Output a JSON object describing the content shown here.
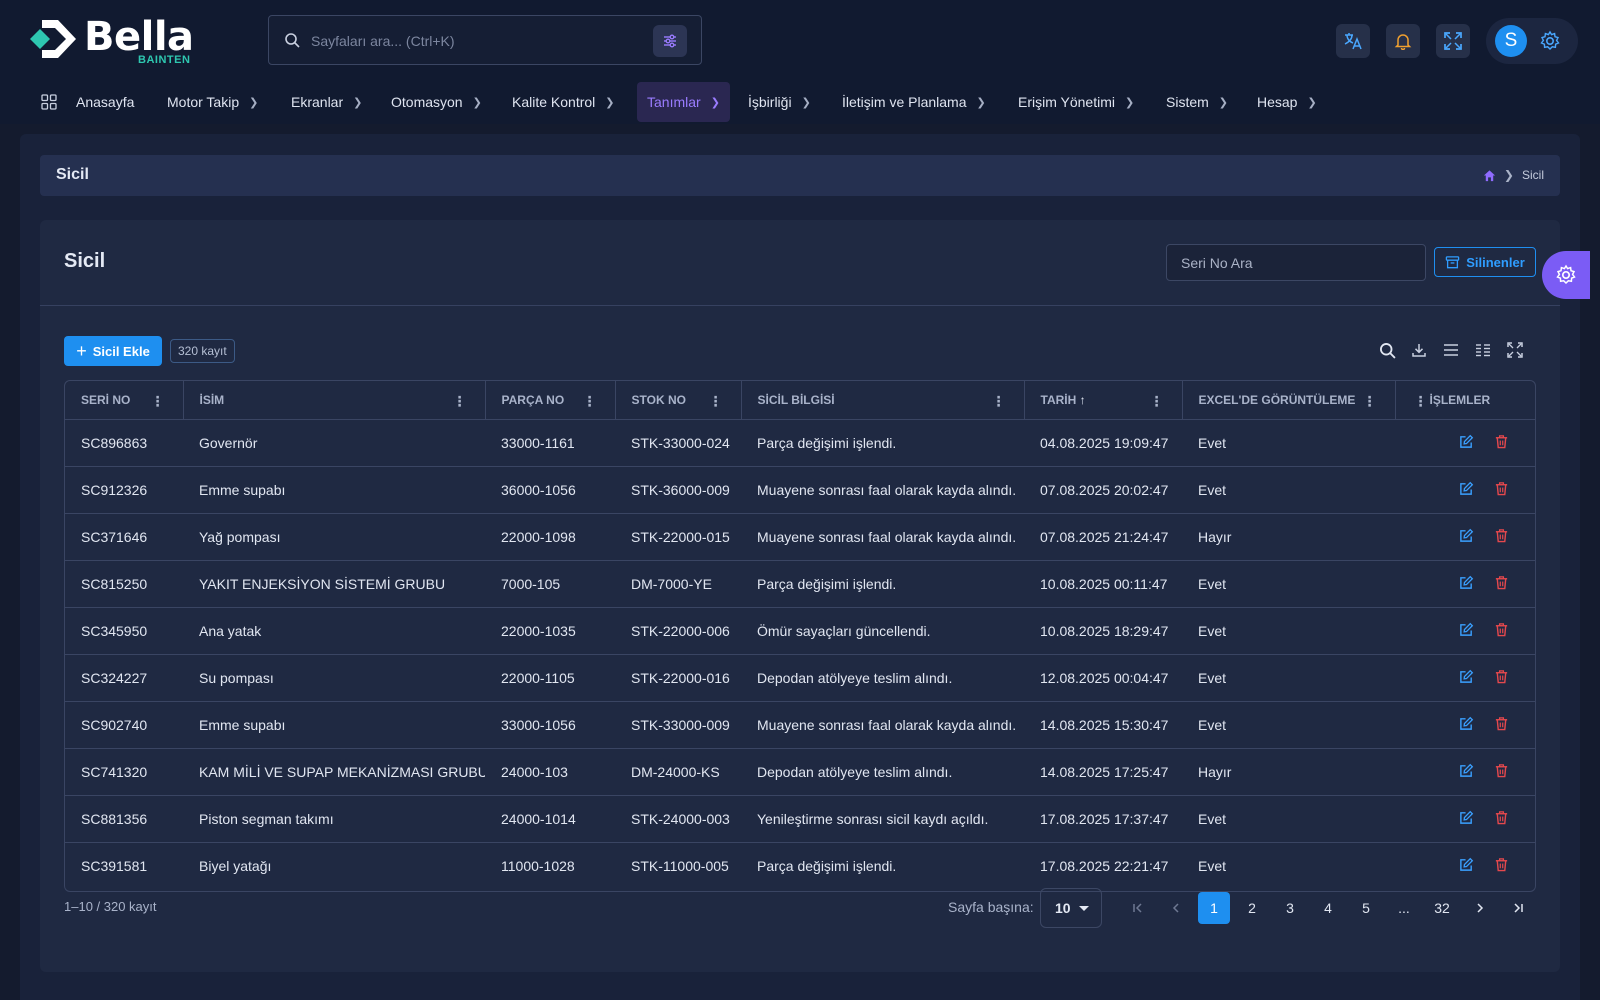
{
  "header": {
    "brand": "Bella",
    "brand_sub": "BAINTEN",
    "search_placeholder": "Sayfaları ara... (Ctrl+K)",
    "user_initial": "S"
  },
  "nav": [
    {
      "label": "Anasayfa"
    },
    {
      "label": "Motor Takip"
    },
    {
      "label": "Ekranlar"
    },
    {
      "label": "Otomasyon"
    },
    {
      "label": "Kalite Kontrol"
    },
    {
      "label": "Tanımlar",
      "active": true
    },
    {
      "label": "İşbirliği"
    },
    {
      "label": "İletişim ve Planlama"
    },
    {
      "label": "Erişim Yönetimi"
    },
    {
      "label": "Sistem"
    },
    {
      "label": "Hesap"
    }
  ],
  "breadcrumb": {
    "page_title": "Sicil",
    "current": "Sicil"
  },
  "card": {
    "title": "Sicil",
    "seri_placeholder": "Seri No Ara",
    "deleted_label": "Silinenler",
    "add_label": "Sicil Ekle",
    "count_badge": "320 kayıt"
  },
  "table": {
    "columns": [
      "SERİ NO",
      "İSİM",
      "PARÇA NO",
      "STOK NO",
      "SİCİL BİLGİSİ",
      "TARİH",
      "EXCEL'DE GÖRÜNTÜLEME",
      "İŞLEMLER"
    ],
    "sort_indicator": "↑",
    "rows": [
      {
        "seri": "SC896863",
        "isim": "Governör",
        "parca": "33000-1161",
        "stok": "STK-33000-024",
        "bilgi": "Parça değişimi işlendi.",
        "tarih": "04.08.2025 19:09:47",
        "excel": "Evet"
      },
      {
        "seri": "SC912326",
        "isim": "Emme supabı",
        "parca": "36000-1056",
        "stok": "STK-36000-009",
        "bilgi": "Muayene sonrası faal olarak kayda alındı.",
        "tarih": "07.08.2025 20:02:47",
        "excel": "Evet"
      },
      {
        "seri": "SC371646",
        "isim": "Yağ pompası",
        "parca": "22000-1098",
        "stok": "STK-22000-015",
        "bilgi": "Muayene sonrası faal olarak kayda alındı.",
        "tarih": "07.08.2025 21:24:47",
        "excel": "Hayır"
      },
      {
        "seri": "SC815250",
        "isim": "YAKIT ENJEKSİYON SİSTEMİ GRUBU",
        "parca": "7000-105",
        "stok": "DM-7000-YE",
        "bilgi": "Parça değişimi işlendi.",
        "tarih": "10.08.2025 00:11:47",
        "excel": "Evet"
      },
      {
        "seri": "SC345950",
        "isim": "Ana yatak",
        "parca": "22000-1035",
        "stok": "STK-22000-006",
        "bilgi": "Ömür sayaçları güncellendi.",
        "tarih": "10.08.2025 18:29:47",
        "excel": "Evet"
      },
      {
        "seri": "SC324227",
        "isim": "Su pompası",
        "parca": "22000-1105",
        "stok": "STK-22000-016",
        "bilgi": "Depodan atölyeye teslim alındı.",
        "tarih": "12.08.2025 00:04:47",
        "excel": "Evet"
      },
      {
        "seri": "SC902740",
        "isim": "Emme supabı",
        "parca": "33000-1056",
        "stok": "STK-33000-009",
        "bilgi": "Muayene sonrası faal olarak kayda alındı.",
        "tarih": "14.08.2025 15:30:47",
        "excel": "Evet"
      },
      {
        "seri": "SC741320",
        "isim": "KAM MİLİ VE SUPAP MEKANİZMASI GRUBU",
        "parca": "24000-103",
        "stok": "DM-24000-KS",
        "bilgi": "Depodan atölyeye teslim alındı.",
        "tarih": "14.08.2025 17:25:47",
        "excel": "Hayır"
      },
      {
        "seri": "SC881356",
        "isim": "Piston segman takımı",
        "parca": "24000-1014",
        "stok": "STK-24000-003",
        "bilgi": "Yenileştirme sonrası sicil kaydı açıldı.",
        "tarih": "17.08.2025 17:37:47",
        "excel": "Evet"
      },
      {
        "seri": "SC391581",
        "isim": "Biyel yatağı",
        "parca": "11000-1028",
        "stok": "STK-11000-005",
        "bilgi": "Parça değişimi işlendi.",
        "tarih": "17.08.2025 22:21:47",
        "excel": "Evet"
      }
    ]
  },
  "footer": {
    "range": "1–10 / 320 kayıt",
    "per_page_label": "Sayfa başına:",
    "per_page_value": "10",
    "pages": [
      "1",
      "2",
      "3",
      "4",
      "5",
      "...",
      "32"
    ],
    "current_page": "1"
  },
  "colors": {
    "accent": "#1e8ff0",
    "nav_active": "#9a7cff",
    "danger": "#e5484d",
    "background": "#141b2e"
  },
  "icons": [
    "logo-mark-icon",
    "search-icon",
    "filter-icon",
    "translate-icon",
    "bell-icon",
    "fullscreen-icon",
    "gear-icon",
    "grid-icon",
    "home-icon",
    "archive-icon",
    "plus-icon",
    "download-icon",
    "density-icon",
    "columns-icon",
    "edit-icon",
    "trash-icon"
  ]
}
